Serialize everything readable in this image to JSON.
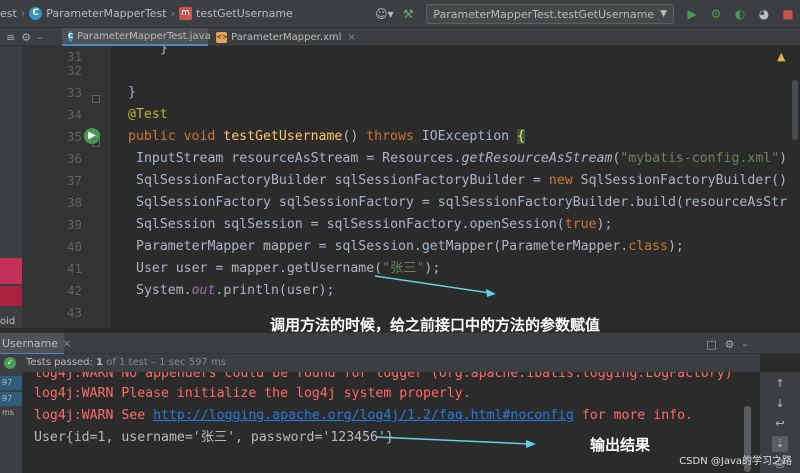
{
  "breadcrumb": {
    "items": [
      "est",
      "ParameterMapperTest",
      "testGetUsername"
    ]
  },
  "toolbar": {
    "run_config": "ParameterMapperTest.testGetUsername"
  },
  "tabs": [
    {
      "label": "ParameterMapperTest.java",
      "active": true
    },
    {
      "label": "ParameterMapper.xml",
      "active": false
    }
  ],
  "editor": {
    "warning_count": "1",
    "lines": [
      {
        "num": "31",
        "text": "}"
      },
      {
        "num": "32",
        "text": ""
      },
      {
        "num": "33",
        "text": "}"
      },
      {
        "num": "34",
        "text": "@Test"
      },
      {
        "num": "35",
        "text": "public void testGetUsername() throws IOException {"
      },
      {
        "num": "36",
        "text": "InputStream resourceAsStream = Resources.getResourceAsStream(\"mybatis-config.xml\")"
      },
      {
        "num": "37",
        "text": "SqlSessionFactoryBuilder sqlSessionFactoryBuilder = new SqlSessionFactoryBuilder()"
      },
      {
        "num": "38",
        "text": "SqlSessionFactory sqlSessionFactory = sqlSessionFactoryBuilder.build(resourceAsStr"
      },
      {
        "num": "39",
        "text": "SqlSession sqlSession = sqlSessionFactory.openSession(true);"
      },
      {
        "num": "40",
        "text": "ParameterMapper mapper = sqlSession.getMapper(ParameterMapper.class);"
      },
      {
        "num": "41",
        "text": "User user = mapper.getUsername(\"张三\");"
      },
      {
        "num": "42",
        "text": "System.out.println(user);"
      },
      {
        "num": "43",
        "text": ""
      }
    ]
  },
  "left_panel": {
    "void_label": "oid"
  },
  "run_panel": {
    "title": "Username",
    "status_prefix": "Tests passed:",
    "status_count": "1",
    "status_suffix": "of 1 test – 1 sec 597 ms",
    "ms_tags": [
      "97 ms",
      "97 ms"
    ],
    "console": {
      "line1": "log4j:WARN No appenders could be found for logger (org.apache.ibatis.logging.LogFactory)",
      "line2": "log4j:WARN Please initialize the log4j system properly.",
      "line3_prefix": "log4j:WARN See ",
      "line3_link": "http://logging.apache.org/log4j/1.2/faq.html#noconfig",
      "line3_suffix": " for more info.",
      "line4": "User{id=1, username='张三', password='123456'}"
    }
  },
  "annotations": {
    "note1": "调用方法的时候，给之前接口中的方法的参数赋值",
    "note2": "输出结果"
  },
  "watermark": "CSDN @Java的学习之路",
  "colors": {
    "background": "#2b2b2b",
    "keyword": "#cc7832",
    "string": "#6a8759",
    "method": "#ffc66d",
    "annotation": "#bbb529",
    "error_text": "#ff6b68",
    "link": "#287bde",
    "arrow": "#5fd3e8"
  }
}
